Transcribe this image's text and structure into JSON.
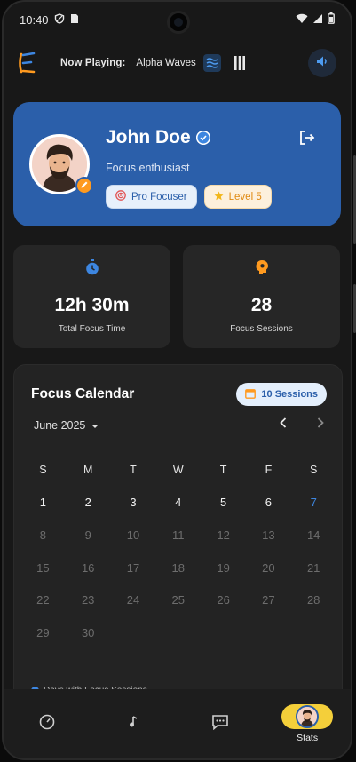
{
  "status_bar": {
    "time": "10:40"
  },
  "header": {
    "now_playing_label": "Now Playing:",
    "track": "Alpha Waves"
  },
  "profile": {
    "name": "John Doe",
    "tagline": "Focus enthusiast",
    "badges": [
      {
        "label": "Pro Focuser"
      },
      {
        "label": "Level 5"
      }
    ]
  },
  "stats": [
    {
      "value": "12h 30m",
      "label": "Total Focus Time"
    },
    {
      "value": "28",
      "label": "Focus Sessions"
    }
  ],
  "calendar": {
    "title": "Focus Calendar",
    "sessions_label": "10 Sessions",
    "month_label": "June 2025",
    "weekdays": [
      "S",
      "M",
      "T",
      "W",
      "T",
      "F",
      "S"
    ],
    "weeks": [
      [
        "1",
        "2",
        "3",
        "4",
        "5",
        "6",
        "7"
      ],
      [
        "8",
        "9",
        "10",
        "11",
        "12",
        "13",
        "14"
      ],
      [
        "15",
        "16",
        "17",
        "18",
        "19",
        "20",
        "21"
      ],
      [
        "22",
        "23",
        "24",
        "25",
        "26",
        "27",
        "28"
      ],
      [
        "29",
        "30",
        "",
        "",
        "",
        "",
        ""
      ]
    ],
    "today": "7",
    "legend_label": "Days with Focus Sessions"
  },
  "bottom_nav": {
    "items": [
      {
        "icon": "timer-icon"
      },
      {
        "icon": "music-note-icon"
      },
      {
        "icon": "chat-icon"
      },
      {
        "icon": "profile-avatar",
        "label": "Stats"
      }
    ]
  },
  "colors": {
    "accent_blue": "#2b5faa",
    "today_blue": "#3d86e0",
    "orange": "#ff9a1f",
    "nav_active": "#f4cf3a"
  }
}
